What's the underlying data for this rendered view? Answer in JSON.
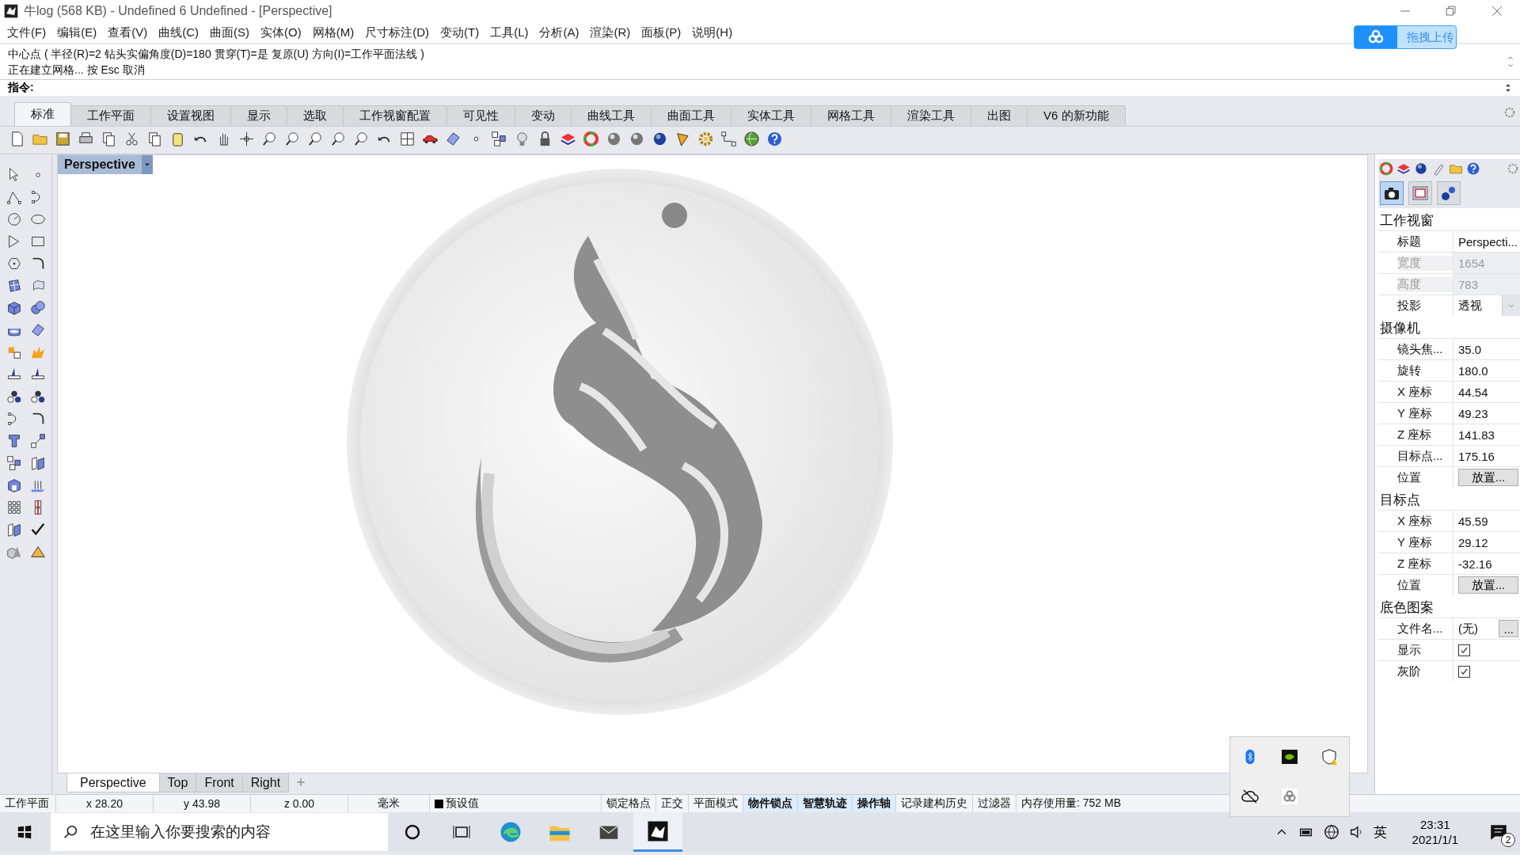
{
  "window": {
    "title": "牛log (568 KB) - Undefined 6 Undefined - [Perspective]"
  },
  "menu": [
    "文件(F)",
    "编辑(E)",
    "查看(V)",
    "曲线(C)",
    "曲面(S)",
    "实体(O)",
    "网格(M)",
    "尺寸标注(D)",
    "变动(T)",
    "工具(L)",
    "分析(A)",
    "渲染(R)",
    "面板(P)",
    "说明(H)"
  ],
  "upload_button": {
    "label": "拖拽上传"
  },
  "command_history": [
    "中心点 ( 半径(R)=2 钻头实偏角度(D)=180 贯穿(T)=是 复原(U) 方向(I)=工作平面法线 )",
    "正在建立网格... 按 Esc 取消"
  ],
  "command_prompt": {
    "label": "指令:"
  },
  "toolbar_tabs": [
    {
      "label": "标准",
      "selected": true
    },
    {
      "label": "工作平面",
      "selected": false
    },
    {
      "label": "设置视图",
      "selected": false
    },
    {
      "label": "显示",
      "selected": false
    },
    {
      "label": "选取",
      "selected": false
    },
    {
      "label": "工作视窗配置",
      "selected": false
    },
    {
      "label": "可见性",
      "selected": false
    },
    {
      "label": "变动",
      "selected": false
    },
    {
      "label": "曲线工具",
      "selected": false
    },
    {
      "label": "曲面工具",
      "selected": false
    },
    {
      "label": "实体工具",
      "selected": false
    },
    {
      "label": "网格工具",
      "selected": false
    },
    {
      "label": "渲染工具",
      "selected": false
    },
    {
      "label": "出图",
      "selected": false
    },
    {
      "label": "V6 的新功能",
      "selected": false
    }
  ],
  "viewport": {
    "title": "Perspective"
  },
  "viewport_tabs": [
    {
      "label": "Perspective",
      "selected": true
    },
    {
      "label": "Top",
      "selected": false
    },
    {
      "label": "Front",
      "selected": false
    },
    {
      "label": "Right",
      "selected": false
    }
  ],
  "panel": {
    "sections": [
      {
        "title": "工作视窗",
        "rows": [
          {
            "kind": "text",
            "label": "标题",
            "value": "Perspecti...",
            "disabled": false
          },
          {
            "kind": "text",
            "label": "宽度",
            "value": "1654",
            "disabled": true
          },
          {
            "kind": "text",
            "label": "高度",
            "value": "783",
            "disabled": true
          },
          {
            "kind": "dropdown",
            "label": "投影",
            "value": "透视"
          }
        ]
      },
      {
        "title": "摄像机",
        "rows": [
          {
            "kind": "text",
            "label": "镜头焦...",
            "value": "35.0",
            "disabled": false
          },
          {
            "kind": "text",
            "label": "旋转",
            "value": "180.0",
            "disabled": false
          },
          {
            "kind": "text",
            "label": "X 座标",
            "value": "44.54",
            "disabled": false
          },
          {
            "kind": "text",
            "label": "Y 座标",
            "value": "49.23",
            "disabled": false
          },
          {
            "kind": "text",
            "label": "Z 座标",
            "value": "141.83",
            "disabled": false
          },
          {
            "kind": "text",
            "label": "目标点...",
            "value": "175.16",
            "disabled": false
          },
          {
            "kind": "button",
            "label": "位置",
            "value": "放置..."
          }
        ]
      },
      {
        "title": "目标点",
        "rows": [
          {
            "kind": "text",
            "label": "X 座标",
            "value": "45.59",
            "disabled": false
          },
          {
            "kind": "text",
            "label": "Y 座标",
            "value": "29.12",
            "disabled": false
          },
          {
            "kind": "text",
            "label": "Z 座标",
            "value": "-32.16",
            "disabled": false
          },
          {
            "kind": "button",
            "label": "位置",
            "value": "放置..."
          }
        ]
      },
      {
        "title": "底色图案",
        "rows": [
          {
            "kind": "file",
            "label": "文件名...",
            "value": "(无)",
            "button": "..."
          },
          {
            "kind": "checkbox",
            "label": "显示",
            "checked": true
          },
          {
            "kind": "checkbox",
            "label": "灰阶",
            "checked": true
          }
        ]
      }
    ]
  },
  "status_bar": {
    "cplane": "工作平面",
    "x": "x 28.20",
    "y": "y 43.98",
    "z": "z 0.00",
    "units": "毫米",
    "layer": "预设值",
    "toggles": [
      {
        "label": "锁定格点",
        "on": false
      },
      {
        "label": "正交",
        "on": false
      },
      {
        "label": "平面模式",
        "on": false
      },
      {
        "label": "物件锁点",
        "on": true
      },
      {
        "label": "智慧轨迹",
        "on": true
      },
      {
        "label": "操作轴",
        "on": true
      },
      {
        "label": "记录建构历史",
        "on": false
      },
      {
        "label": "过滤器",
        "on": false
      }
    ],
    "memory": "内存使用量: 752 MB"
  },
  "taskbar": {
    "search": {
      "placeholder": "在这里输入你要搜索的内容"
    },
    "ime": "英",
    "time": "23:31",
    "date": "2021/1/1",
    "notifications": "2"
  }
}
